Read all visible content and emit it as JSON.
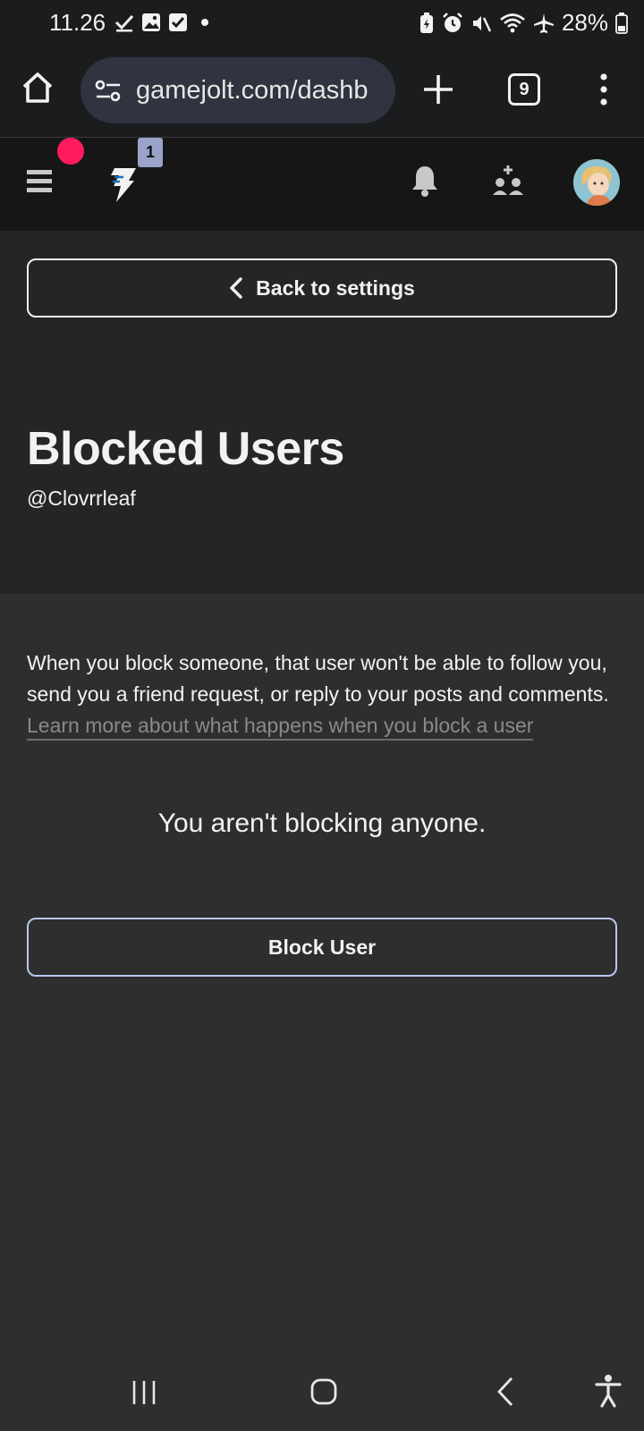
{
  "status_bar": {
    "time": "11.26",
    "battery": "28%",
    "left_icons": [
      "check-icon",
      "image-icon",
      "task-icon",
      "dot-icon"
    ],
    "right_icons": [
      "battery-saver-icon",
      "alarm-icon",
      "mute-icon",
      "wifi-icon",
      "airplane-icon",
      "battery-icon"
    ]
  },
  "browser": {
    "url": "gamejolt.com/dashb",
    "tab_count": "9"
  },
  "site_header": {
    "logo_badge": "1",
    "accent_color": "#ff1b5e"
  },
  "page": {
    "back_label": "Back to settings",
    "title": "Blocked Users",
    "username": "@Clovrrleaf"
  },
  "content": {
    "description": "When you block someone, that user won't be able to follow you, send you a friend request, or reply to your posts and comments.",
    "learn_more": "Learn more about what happens when you block a user",
    "empty_message": "You aren't blocking anyone.",
    "block_button": "Block User"
  }
}
